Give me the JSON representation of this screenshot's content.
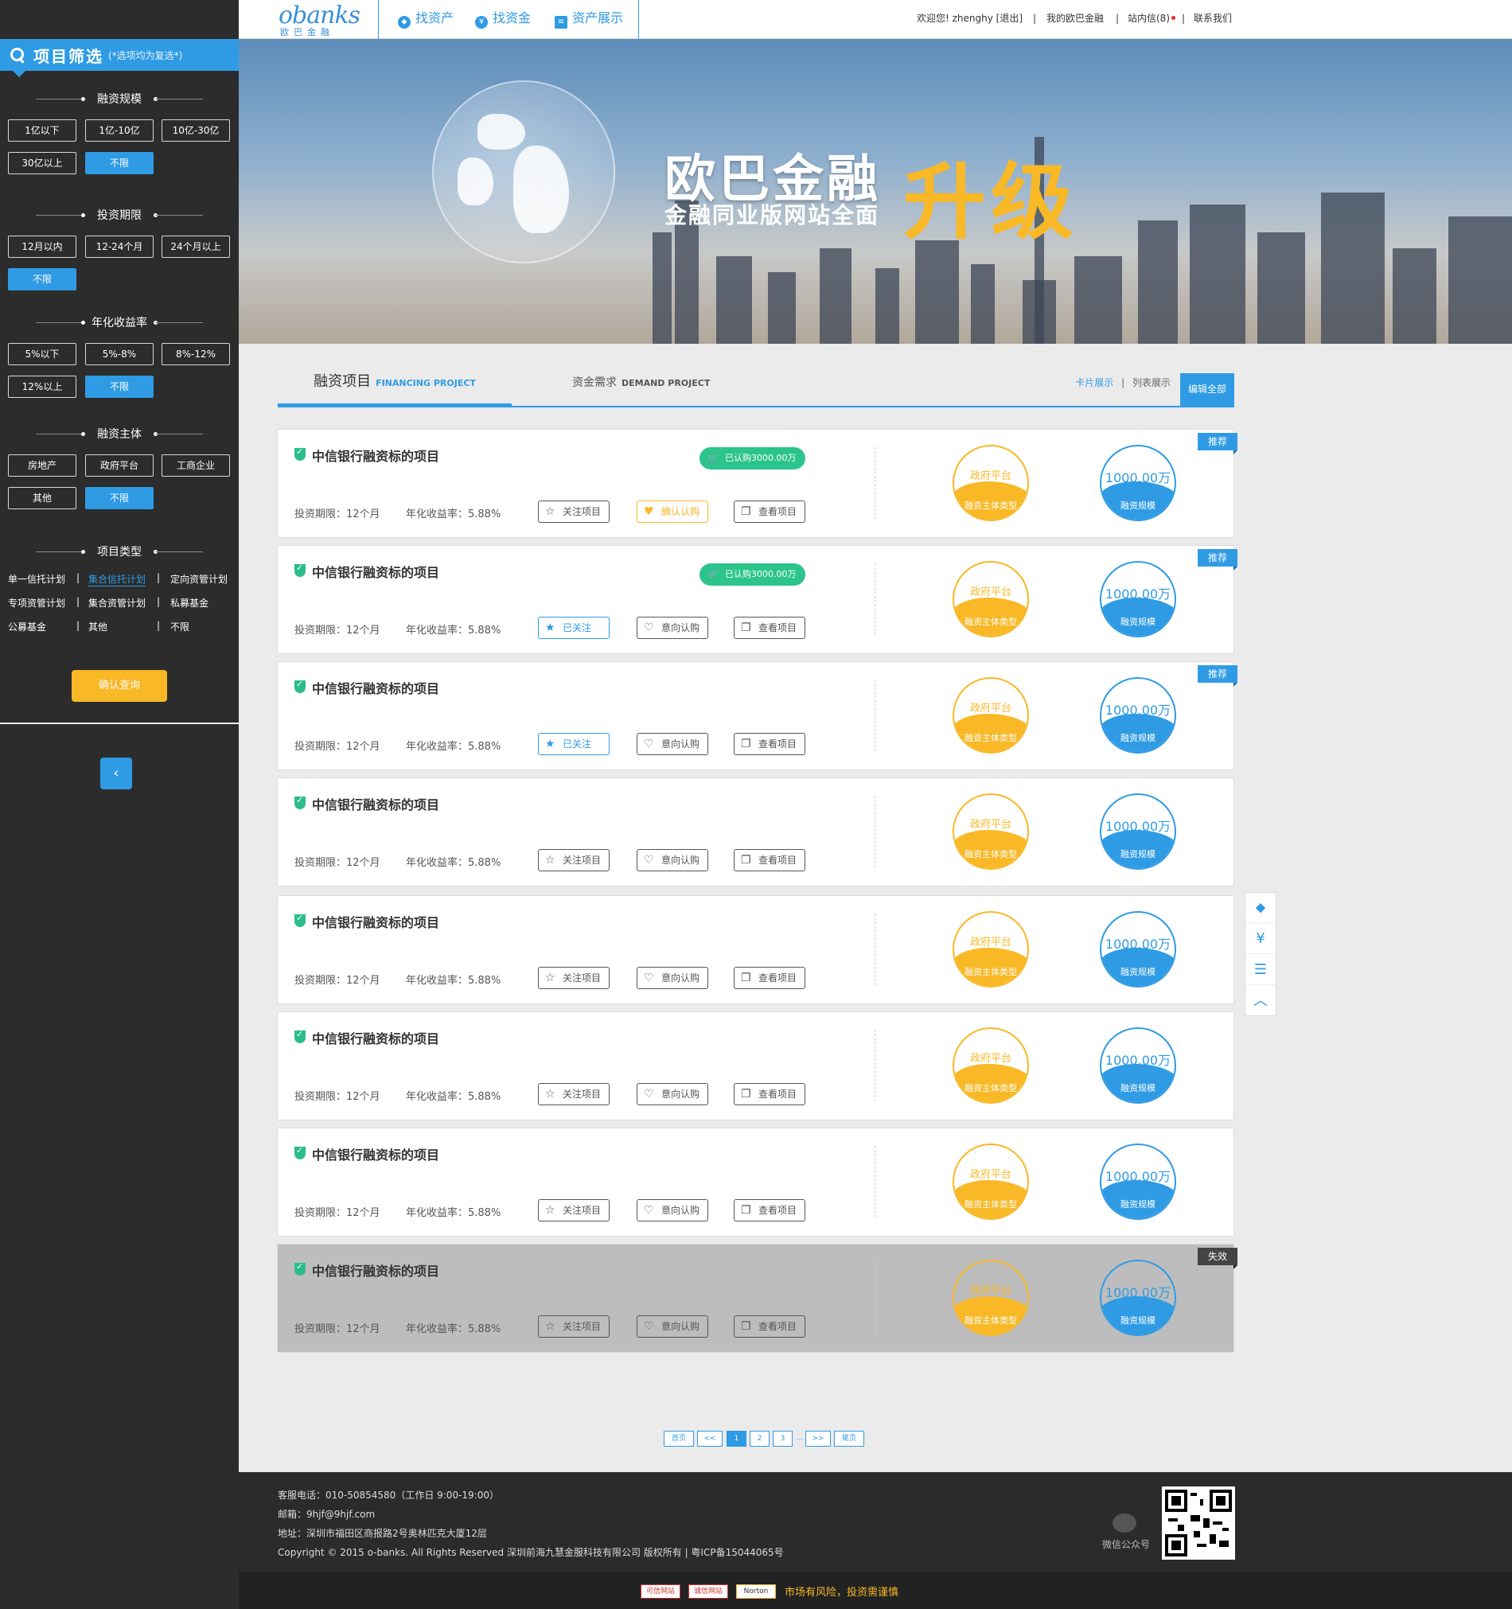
{
  "sidebar": {
    "title": "项目筛选",
    "note": "(*选项均为复选*)",
    "sections": [
      {
        "title": "融资规模",
        "options": [
          "1亿以下",
          "1亿-10亿",
          "10亿-30亿",
          "30亿以上",
          "不限"
        ]
      },
      {
        "title": "投资期限",
        "options": [
          "12月以内",
          "12-24个月",
          "24个月以上",
          "不限"
        ]
      },
      {
        "title": "年化收益率",
        "options": [
          "5%以下",
          "5%-8%",
          "8%-12%",
          "12%以上",
          "不限"
        ]
      },
      {
        "title": "融资主体",
        "options": [
          "房地产",
          "政府平台",
          "工商企业",
          "其他",
          "不限"
        ]
      },
      {
        "title": "项目类型",
        "options": [
          "单一信托计划",
          "集合信托计划",
          "定向资管计划",
          "专项资管计划",
          "集合资管计划",
          "私募基金",
          "公募基金",
          "其他",
          "不限"
        ]
      }
    ],
    "confirm": "确认查询",
    "collapse_icon": "‹",
    "accent": "#2f9be4",
    "confirm_color": "#f9b826"
  },
  "nav": {
    "logo_main": "obanks",
    "logo_sub": "欧巴金融",
    "items": [
      {
        "label": "找资产",
        "icon": "tag-icon"
      },
      {
        "label": "找资金",
        "icon": "yen-icon"
      },
      {
        "label": "资产展示",
        "icon": "list-icon"
      }
    ],
    "welcome": "欢迎您! zhenghy [退出]",
    "my": "我的欧巴金融",
    "mail": "站内信(8)",
    "contact": "联系我们",
    "sep": "|"
  },
  "banner": {
    "line1": "欧巴金融",
    "line2": "升级",
    "line3": "金融同业版网站全面"
  },
  "tabs": {
    "t1_cn": "融资项目",
    "t1_en": "FINANCING PROJECT",
    "t2_cn": "资金需求",
    "t2_en": "DEMAND PROJECT",
    "card_view": "卡片展示",
    "sep": "|",
    "list_view": "列表展示",
    "edit_all": "编辑全部"
  },
  "cards": [
    {
      "title": "中信银行融资标的项目",
      "bought": "已认购3000.00万",
      "term": "投资期限：12个月",
      "yield": "年化收益率：5.88%",
      "b1": "关注项目",
      "b2": "确认认购",
      "b3": "查看项目",
      "c1_top": "政府平台",
      "c1_bot": "融资主体类型",
      "c2_top": "1000.00万",
      "c2_bot": "融资规模",
      "ribbon": "推荐"
    },
    {
      "title": "中信银行融资标的项目",
      "bought": "已认购3000.00万",
      "term": "投资期限：12个月",
      "yield": "年化收益率：5.88%",
      "b1": "已关注",
      "b2": "意向认购",
      "b3": "查看项目",
      "c1_top": "政府平台",
      "c1_bot": "融资主体类型",
      "c2_top": "1000.00万",
      "c2_bot": "融资规模",
      "ribbon": "推荐"
    },
    {
      "title": "中信银行融资标的项目",
      "term": "投资期限：12个月",
      "yield": "年化收益率：5.88%",
      "b1": "已关注",
      "b2": "意向认购",
      "b3": "查看项目",
      "c1_top": "政府平台",
      "c1_bot": "融资主体类型",
      "c2_top": "1000.00万",
      "c2_bot": "融资规模",
      "ribbon": "推荐"
    },
    {
      "title": "中信银行融资标的项目",
      "term": "投资期限：12个月",
      "yield": "年化收益率：5.88%",
      "b1": "关注项目",
      "b2": "意向认购",
      "b3": "查看项目",
      "c1_top": "政府平台",
      "c1_bot": "融资主体类型",
      "c2_top": "1000.00万",
      "c2_bot": "融资规模"
    },
    {
      "title": "中信银行融资标的项目",
      "term": "投资期限：12个月",
      "yield": "年化收益率：5.88%",
      "b1": "关注项目",
      "b2": "意向认购",
      "b3": "查看项目",
      "c1_top": "政府平台",
      "c1_bot": "融资主体类型",
      "c2_top": "1000.00万",
      "c2_bot": "融资规模"
    },
    {
      "title": "中信银行融资标的项目",
      "term": "投资期限：12个月",
      "yield": "年化收益率：5.88%",
      "b1": "关注项目",
      "b2": "意向认购",
      "b3": "查看项目",
      "c1_top": "政府平台",
      "c1_bot": "融资主体类型",
      "c2_top": "1000.00万",
      "c2_bot": "融资规模"
    },
    {
      "title": "中信银行融资标的项目",
      "term": "投资期限：12个月",
      "yield": "年化收益率：5.88%",
      "b1": "关注项目",
      "b2": "意向认购",
      "b3": "查看项目",
      "c1_top": "政府平台",
      "c1_bot": "融资主体类型",
      "c2_top": "1000.00万",
      "c2_bot": "融资规模"
    },
    {
      "title": "中信银行融资标的项目",
      "term": "投资期限：12个月",
      "yield": "年化收益率：5.88%",
      "b1": "关注项目",
      "b2": "意向认购",
      "b3": "查看项目",
      "c1_top": "政府平台",
      "c1_bot": "融资主体类型",
      "c2_top": "1000.00万",
      "c2_bot": "融资规模",
      "ribbon": "失效"
    }
  ],
  "floatbar": {
    "icons": [
      "tag-icon",
      "yen-icon",
      "list-icon",
      "back-to-top-icon"
    ]
  },
  "pagination": [
    "首页",
    "<<",
    "1",
    "2",
    "3",
    "...",
    ">>",
    "尾页"
  ],
  "footer": {
    "phone": "客服电话：010-50854580（工作日 9:00-19:00）",
    "email": "邮箱：9hjf@9hjf.com",
    "address": "地址：深圳市福田区商报路2号奥林匹克大厦12层",
    "copyright": "Copyright © 2015 o-banks. All Rights Reserved 深圳前海九慧金服科技有限公司 版权所有 | 粤ICP备15044065号",
    "wechat": "微信公众号",
    "risk": "市场有风险，投资需谨慎"
  }
}
